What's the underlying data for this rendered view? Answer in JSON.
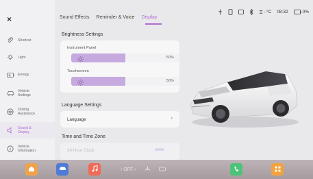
{
  "sidebar": {
    "close_label": "×",
    "items": [
      {
        "label": "Shortcut",
        "icon": "paperclip-icon"
      },
      {
        "label": "Light",
        "icon": "light-bulb-icon"
      },
      {
        "label": "Energy",
        "icon": "battery-icon"
      },
      {
        "label": "Vehicle\nSettings",
        "icon": "car-icon"
      },
      {
        "label": "Driving\nAssistance",
        "icon": "steering-wheel-icon"
      },
      {
        "label": "Sound &\nDisplay",
        "icon": "speaker-icon",
        "active": true
      },
      {
        "label": "Vehicle\nInformation",
        "icon": "info-icon"
      }
    ]
  },
  "tabs": [
    {
      "label": "Sound Effects"
    },
    {
      "label": "Reminder & Voice"
    },
    {
      "label": "Display",
      "active": true
    }
  ],
  "status_bar": {
    "temperature": "--°C",
    "time": "08:32",
    "battery": "0%"
  },
  "brightness": {
    "section_title": "Brightness Settings",
    "instrument_panel": {
      "label": "Instrument Panel",
      "value_text": "50%",
      "value": 0.5
    },
    "touchscreen": {
      "label": "Touchscreen",
      "value_text": "50%",
      "value": 0.5
    }
  },
  "language": {
    "section_title": "Language Settings",
    "row_label": "Language",
    "chevron": "›"
  },
  "time_zone": {
    "section_title": "Time and Time Zone",
    "row_label": "24-Hour Clock"
  },
  "dock": {
    "climate_text": "‹ OFF ›"
  },
  "colors": {
    "accent": "#b06cd1",
    "slider_fill": "#c6a9de",
    "home_app": "#f0a24a",
    "car_app": "#4f7bd6",
    "music_app": "#f06a58",
    "phone_app": "#4cc27a",
    "apps_app": "#f2a33d"
  }
}
